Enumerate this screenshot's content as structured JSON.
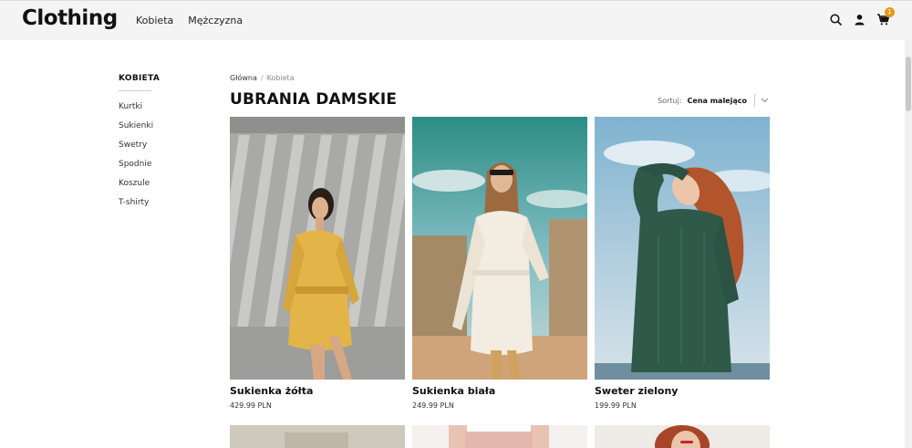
{
  "header": {
    "logo": "Clothing",
    "nav": [
      "Kobieta",
      "Mężczyzna"
    ],
    "cart_count": "1"
  },
  "sidebar": {
    "title": "KOBIETA",
    "items": [
      "Kurtki",
      "Sukienki",
      "Swetry",
      "Spodnie",
      "Koszule",
      "T-shirty"
    ]
  },
  "breadcrumb": {
    "home": "Główna",
    "separator": "/",
    "current": "Kobieta"
  },
  "page_title": "UBRANIA DAMSKIE",
  "sort": {
    "label": "Sortuj:",
    "value": "Cena malejąco"
  },
  "products": [
    {
      "name": "Sukienka żółta",
      "price": "429.99 PLN"
    },
    {
      "name": "Sukienka biała",
      "price": "249.99 PLN"
    },
    {
      "name": "Sweter zielony",
      "price": "199.99 PLN"
    }
  ],
  "colors": {
    "accent": "#e39a1a",
    "header_bg": "#f4f4f4"
  }
}
